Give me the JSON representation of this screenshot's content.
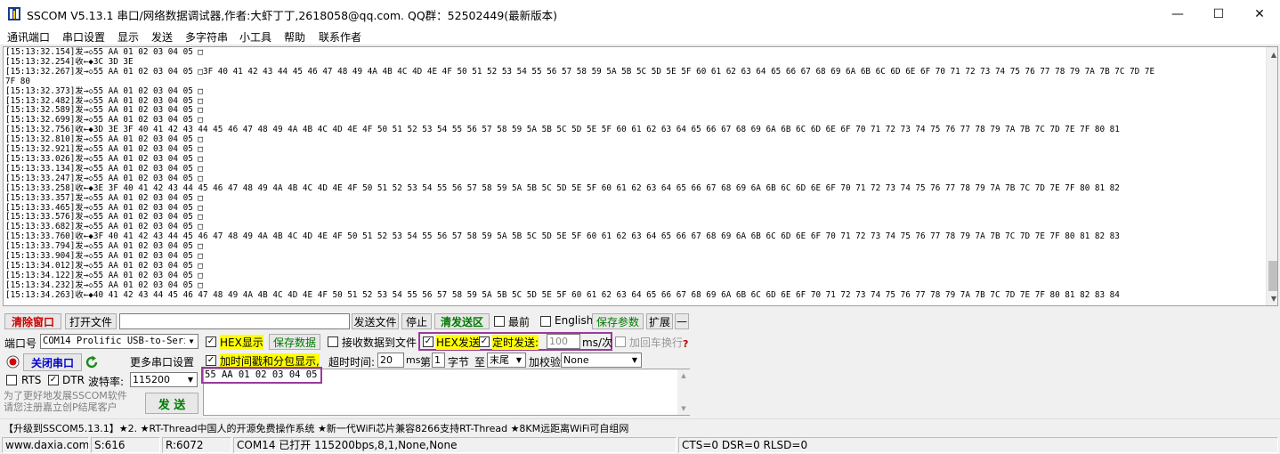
{
  "window": {
    "title": "SSCOM V5.13.1 串口/网络数据调试器,作者:大虾丁丁,2618058@qq.com. QQ群：52502449(最新版本)",
    "controls": {
      "minimize": "—",
      "maximize": "☐",
      "close": "✕"
    }
  },
  "menu": [
    "通讯端口",
    "串口设置",
    "显示",
    "发送",
    "多字符串",
    "小工具",
    "帮助",
    "联系作者"
  ],
  "log": {
    "lines": [
      "[15:13:32.154]发→◇55 AA 01 02 03 04 05 □",
      "[15:13:32.254]收←◆3C 3D 3E",
      "[15:13:32.267]发→◇55 AA 01 02 03 04 05 □3F 40 41 42 43 44 45 46 47 48 49 4A 4B 4C 4D 4E 4F 50 51 52 53 54 55 56 57 58 59 5A 5B 5C 5D 5E 5F 60 61 62 63 64 65 66 67 68 69 6A 6B 6C 6D 6E 6F 70 71 72 73 74 75 76 77 78 79 7A 7B 7C 7D 7E",
      "7F 80",
      "[15:13:32.373]发→◇55 AA 01 02 03 04 05 □",
      "[15:13:32.482]发→◇55 AA 01 02 03 04 05 □",
      "[15:13:32.589]发→◇55 AA 01 02 03 04 05 □",
      "[15:13:32.699]发→◇55 AA 01 02 03 04 05 □",
      "[15:13:32.756]收←◆3D 3E 3F 40 41 42 43 44 45 46 47 48 49 4A 4B 4C 4D 4E 4F 50 51 52 53 54 55 56 57 58 59 5A 5B 5C 5D 5E 5F 60 61 62 63 64 65 66 67 68 69 6A 6B 6C 6D 6E 6F 70 71 72 73 74 75 76 77 78 79 7A 7B 7C 7D 7E 7F 80 81",
      "[15:13:32.810]发→◇55 AA 01 02 03 04 05 □",
      "[15:13:32.921]发→◇55 AA 01 02 03 04 05 □",
      "[15:13:33.026]发→◇55 AA 01 02 03 04 05 □",
      "[15:13:33.134]发→◇55 AA 01 02 03 04 05 □",
      "[15:13:33.247]发→◇55 AA 01 02 03 04 05 □",
      "[15:13:33.258]收←◆3E 3F 40 41 42 43 44 45 46 47 48 49 4A 4B 4C 4D 4E 4F 50 51 52 53 54 55 56 57 58 59 5A 5B 5C 5D 5E 5F 60 61 62 63 64 65 66 67 68 69 6A 6B 6C 6D 6E 6F 70 71 72 73 74 75 76 77 78 79 7A 7B 7C 7D 7E 7F 80 81 82",
      "[15:13:33.357]发→◇55 AA 01 02 03 04 05 □",
      "[15:13:33.465]发→◇55 AA 01 02 03 04 05 □",
      "[15:13:33.576]发→◇55 AA 01 02 03 04 05 □",
      "[15:13:33.682]发→◇55 AA 01 02 03 04 05 □",
      "[15:13:33.760]收←◆3F 40 41 42 43 44 45 46 47 48 49 4A 4B 4C 4D 4E 4F 50 51 52 53 54 55 56 57 58 59 5A 5B 5C 5D 5E 5F 60 61 62 63 64 65 66 67 68 69 6A 6B 6C 6D 6E 6F 70 71 72 73 74 75 76 77 78 79 7A 7B 7C 7D 7E 7F 80 81 82 83",
      "[15:13:33.794]发→◇55 AA 01 02 03 04 05 □",
      "[15:13:33.904]发→◇55 AA 01 02 03 04 05 □",
      "[15:13:34.012]发→◇55 AA 01 02 03 04 05 □",
      "[15:13:34.122]发→◇55 AA 01 02 03 04 05 □",
      "[15:13:34.232]发→◇55 AA 01 02 03 04 05 □",
      "[15:13:34.263]收←◆40 41 42 43 44 45 46 47 48 49 4A 4B 4C 4D 4E 4F 50 51 52 53 54 55 56 57 58 59 5A 5B 5C 5D 5E 5F 60 61 62 63 64 65 66 67 68 69 6A 6B 6C 6D 6E 6F 70 71 72 73 74 75 76 77 78 79 7A 7B 7C 7D 7E 7F 80 81 82 83 84"
    ]
  },
  "toolbar": {
    "clear_window": "清除窗口",
    "open_file": "打开文件",
    "file_path": "",
    "send_file": "发送文件",
    "stop": "停止",
    "clear_send_area": "清发送区",
    "topmost": "最前",
    "english": "English",
    "save_params": "保存参数",
    "expand": "扩展",
    "collapse": "—"
  },
  "controls": {
    "port_label": "端口号",
    "port_value": "COM14 Prolific USB-to-Seri",
    "hex_display": "HEX显示",
    "save_data": "保存数据",
    "recv_to_file": "接收数据到文件",
    "hex_send": "HEX发送",
    "timed_send": "定时发送:",
    "interval_value": "100",
    "interval_unit": "ms/次",
    "append_crlf": "加回车换行",
    "close_port": "关闭串口",
    "more_settings": "更多串口设置",
    "timestamp_split": "加时间戳和分包显示,",
    "timeout_label": "超时时间:",
    "timeout_value": "20",
    "timeout_unit": "ms",
    "byte_prefix": "第",
    "byte_index": "1",
    "byte_label": "字节",
    "to_label": "至",
    "tail_value": "末尾",
    "checksum_label": "加校验",
    "checksum_value": "None",
    "rts": "RTS",
    "dtr": "DTR",
    "baud_label": "波特率:",
    "baud_value": "115200",
    "send_button": "发 送",
    "send_text": "55 AA 01 02 03 04 05",
    "promo_text": "为了更好地发展SSCOM软件\n请您注册嘉立创P结尾客户"
  },
  "adbar": {
    "text": "【升级到SSCOM5.13.1】★2. ★RT-Thread中国人的开源免费操作系统 ★新一代WiFi芯片兼容8266支持RT-Thread ★8KM远距离WiFi可自组网"
  },
  "statusbar": {
    "website": "www.daxia.com",
    "sent": "S:616",
    "received": "R:6072",
    "port_status": "COM14 已打开  115200bps,8,1,None,None",
    "signals": "CTS=0 DSR=0 RLSD=0"
  },
  "colors": {
    "highlight_yellow": "#ffff00",
    "annotation_box": "#9b3a9b",
    "clear_window_text": "#cc0000",
    "green_text": "#007a00",
    "close_port_blue": "#0000cc"
  },
  "icons": {
    "app": "sscom-icon",
    "port_state": "record-icon",
    "refresh": "refresh-icon",
    "help": "help-icon"
  }
}
